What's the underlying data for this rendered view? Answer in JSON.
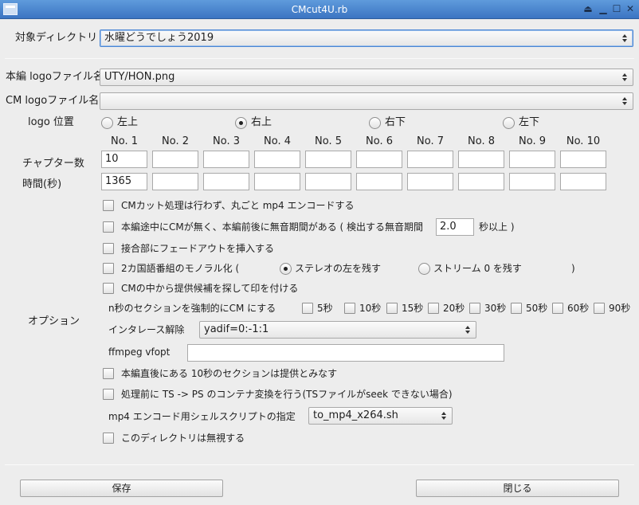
{
  "window": {
    "title": "CMcut4U.rb"
  },
  "dir": {
    "label": "対象ディレクトリ",
    "value": "水曜どうでしょう2019"
  },
  "logo": {
    "main_label": "本編 logoファイル名",
    "main_value": "UTY/HON.png",
    "cm_label": "CM logoファイル名",
    "cm_value": "",
    "pos_label": "logo 位置",
    "positions": [
      "左上",
      "右上",
      "右下",
      "左下"
    ],
    "selected": 1
  },
  "chapters": {
    "headers": [
      "No. 1",
      "No. 2",
      "No. 3",
      "No. 4",
      "No. 5",
      "No. 6",
      "No. 7",
      "No. 8",
      "No. 9",
      "No. 10"
    ],
    "count_label": "チャプター数",
    "time_label": "時間(秒)",
    "counts": [
      "10",
      "",
      "",
      "",
      "",
      "",
      "",
      "",
      "",
      ""
    ],
    "times": [
      "1365",
      "",
      "",
      "",
      "",
      "",
      "",
      "",
      "",
      ""
    ]
  },
  "options": {
    "label": "オプション",
    "no_cut": "CMカット処理は行わず、丸ごと mp4 エンコードする",
    "silence_pre": "本編途中にCMが無く、本編前後に無音期間がある ( 検出する無音期間",
    "silence_value": "2.0",
    "silence_post": "秒以上 )",
    "fade": "接合部にフェードアウトを挿入する",
    "mono_pre": "2カ国語番組のモノラル化 (",
    "mono_left": "ステレオの左を残す",
    "mono_stream": "ストリーム 0 を残す",
    "mono_post": ")",
    "mark": "CMの中から提供候補を探して印を付ける",
    "force_label": "n秒のセクションを強制的にCM にする",
    "force_secs": [
      "5秒",
      "10秒",
      "15秒",
      "20秒",
      "30秒",
      "50秒",
      "60秒",
      "90秒"
    ],
    "deint_label": "インタレース解除",
    "deint_value": "yadif=0:-1:1",
    "vfopt_label": "ffmpeg vfopt",
    "vfopt_value": "",
    "sponsor10": "本編直後にある 10秒のセクションは提供とみなす",
    "ts2ps": "処理前に TS -> PS のコンテナ変換を行う(TSファイルがseek できない場合)",
    "script_label": "mp4 エンコード用シェルスクリプトの指定",
    "script_value": "to_mp4_x264.sh",
    "ignore": "このディレクトリは無視する"
  },
  "buttons": {
    "save": "保存",
    "close": "閉じる"
  }
}
